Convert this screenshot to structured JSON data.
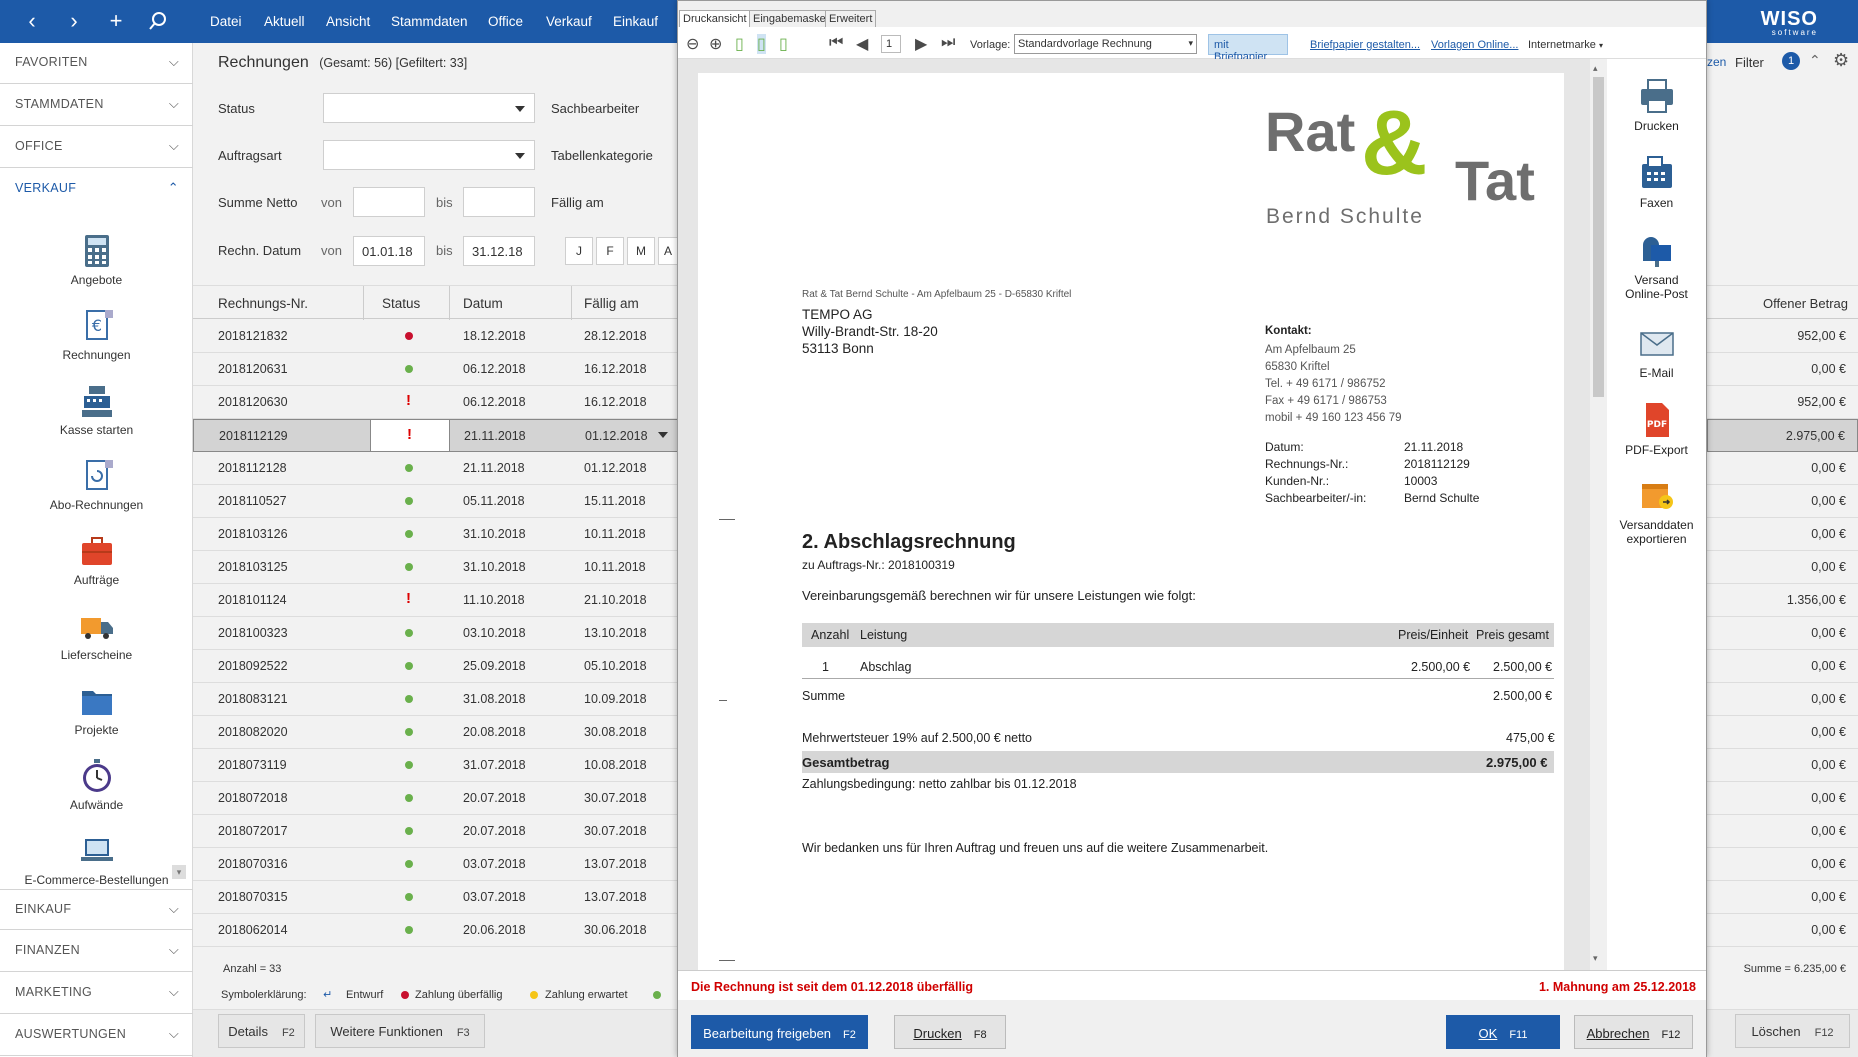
{
  "topbar": {
    "menu": [
      "Datei",
      "Aktuell",
      "Ansicht",
      "Stammdaten",
      "Office",
      "Verkauf",
      "Einkauf"
    ],
    "brand": "WISO",
    "brand_sub": "software"
  },
  "sidebar": {
    "sections_top": [
      "FAVORITEN",
      "STAMMDATEN",
      "OFFICE",
      "VERKAUF"
    ],
    "modules": [
      "Angebote",
      "Rechnungen",
      "Kasse starten",
      "Abo-Rechnungen",
      "Aufträge",
      "Lieferscheine",
      "Projekte",
      "Aufwände",
      "E-Commerce-Bestellungen"
    ],
    "sections_bottom": [
      "EINKAUF",
      "FINANZEN",
      "MARKETING",
      "AUSWERTUNGEN"
    ]
  },
  "list": {
    "title": "Rechnungen",
    "counts": "(Gesamt: 56) [Gefiltert: 33]",
    "filters": {
      "status_label": "Status",
      "sachbearbeiter_label": "Sachbearbeiter",
      "auftragsart_label": "Auftragsart",
      "tabellenkategorie_label": "Tabellenkategorie",
      "summe_label": "Summe Netto",
      "von": "von",
      "bis": "bis",
      "faellig_label": "Fällig am",
      "datum_label": "Rechn. Datum",
      "datum_von": "01.01.18",
      "datum_bis": "31.12.18",
      "period_buttons": [
        "J",
        "F",
        "M",
        "A"
      ]
    },
    "columns": [
      "Rechnungs-Nr.",
      "Status",
      "Datum",
      "Fällig am"
    ],
    "rows": [
      {
        "nr": "2018121832",
        "status": "red",
        "datum": "18.12.2018",
        "faellig": "28.12.2018"
      },
      {
        "nr": "2018120631",
        "status": "green",
        "datum": "06.12.2018",
        "faellig": "16.12.2018"
      },
      {
        "nr": "2018120630",
        "status": "excl",
        "datum": "06.12.2018",
        "faellig": "16.12.2018"
      },
      {
        "nr": "2018112129",
        "status": "excl",
        "datum": "21.11.2018",
        "faellig": "01.12.2018"
      },
      {
        "nr": "2018112128",
        "status": "green",
        "datum": "21.11.2018",
        "faellig": "01.12.2018"
      },
      {
        "nr": "2018110527",
        "status": "green",
        "datum": "05.11.2018",
        "faellig": "15.11.2018"
      },
      {
        "nr": "2018103126",
        "status": "green",
        "datum": "31.10.2018",
        "faellig": "10.11.2018"
      },
      {
        "nr": "2018103125",
        "status": "green",
        "datum": "31.10.2018",
        "faellig": "10.11.2018"
      },
      {
        "nr": "2018101124",
        "status": "excl",
        "datum": "11.10.2018",
        "faellig": "21.10.2018"
      },
      {
        "nr": "2018100323",
        "status": "green",
        "datum": "03.10.2018",
        "faellig": "13.10.2018"
      },
      {
        "nr": "2018092522",
        "status": "green",
        "datum": "25.09.2018",
        "faellig": "05.10.2018"
      },
      {
        "nr": "2018083121",
        "status": "green",
        "datum": "31.08.2018",
        "faellig": "10.09.2018"
      },
      {
        "nr": "2018082020",
        "status": "green",
        "datum": "20.08.2018",
        "faellig": "30.08.2018"
      },
      {
        "nr": "2018073119",
        "status": "green",
        "datum": "31.07.2018",
        "faellig": "10.08.2018"
      },
      {
        "nr": "2018072018",
        "status": "green",
        "datum": "20.07.2018",
        "faellig": "30.07.2018"
      },
      {
        "nr": "2018072017",
        "status": "green",
        "datum": "20.07.2018",
        "faellig": "30.07.2018"
      },
      {
        "nr": "2018070316",
        "status": "green",
        "datum": "03.07.2018",
        "faellig": "13.07.2018"
      },
      {
        "nr": "2018070315",
        "status": "green",
        "datum": "03.07.2018",
        "faellig": "13.07.2018"
      },
      {
        "nr": "2018062014",
        "status": "green",
        "datum": "20.06.2018",
        "faellig": "30.06.2018"
      }
    ],
    "anzahl": "Anzahl = 33",
    "legend": {
      "label": "Symbolerklärung:",
      "entwurf": "Entwurf",
      "ueberfaellig": "Zahlung überfällig",
      "erwartet": "Zahlung erwartet"
    },
    "buttons": {
      "details": "Details",
      "details_key": "F2",
      "weitere": "Weitere Funktionen",
      "weitere_key": "F3"
    }
  },
  "right": {
    "zen": "zen",
    "filter": "Filter",
    "filter_count": "1",
    "col_head": "Offener Betrag",
    "values": [
      "952,00 €",
      "0,00 €",
      "952,00 €",
      "2.975,00 €",
      "0,00 €",
      "0,00 €",
      "0,00 €",
      "0,00 €",
      "1.356,00 €",
      "0,00 €",
      "0,00 €",
      "0,00 €",
      "0,00 €",
      "0,00 €",
      "0,00 €",
      "0,00 €",
      "0,00 €",
      "0,00 €",
      "0,00 €"
    ],
    "summe": "Summe = 6.235,00 €",
    "loeschen": "Löschen",
    "loeschen_key": "F12"
  },
  "dialog": {
    "tabs": [
      "Druckansicht",
      "Eingabemaske",
      "Erweitert"
    ],
    "toolbar": {
      "page": "1",
      "vorlage_label": "Vorlage:",
      "vorlage_value": "Standardvorlage Rechnung",
      "briefpapier_btn": "mit Briefpapier",
      "link1": "Briefpapier gestalten...",
      "link2": "Vorlagen Online...",
      "internetmarke": "Internetmarke"
    },
    "invoice": {
      "logo_rat": "Rat",
      "logo_amp": "&",
      "logo_tat": "Tat",
      "logo_sub": "Bernd Schulte",
      "sender_line": "Rat & Tat Bernd Schulte - Am Apfelbaum 25 - D-65830 Kriftel",
      "recipient": [
        "TEMPO AG",
        "Willy-Brandt-Str. 18-20",
        "53113 Bonn"
      ],
      "kontakt_label": "Kontakt:",
      "kontakt": [
        "Am Apfelbaum 25",
        "65830 Kriftel",
        "Tel. + 49 6171 / 986752",
        "Fax + 49 6171 / 986753",
        "mobil + 49 160 123 456 79"
      ],
      "meta_labels": [
        "Datum:",
        "Rechnungs-Nr.:",
        "Kunden-Nr.:",
        "Sachbearbeiter/-in:"
      ],
      "meta_values": [
        "21.11.2018",
        "2018112129",
        "10003",
        "Bernd Schulte"
      ],
      "heading": "2. Abschlagsrechnung",
      "auftrag": "zu Auftrags-Nr.: 2018100319",
      "intro": "Vereinbarungsgemäß berechnen wir für unsere Leistungen wie folgt:",
      "col_anzahl": "Anzahl",
      "col_leistung": "Leistung",
      "col_preis": "Preis/Einheit",
      "col_gesamt": "Preis gesamt",
      "item_anzahl": "1",
      "item_leistung": "Abschlag",
      "item_preis": "2.500,00 €",
      "item_gesamt": "2.500,00 €",
      "summe_label": "Summe",
      "summe_value": "2.500,00 €",
      "mwst_label": "Mehrwertsteuer 19% auf 2.500,00 € netto",
      "mwst_value": "475,00 €",
      "gesamt_label": "Gesamtbetrag",
      "gesamt_value": "2.975,00 €",
      "zahlung": "Zahlungsbedingung: netto zahlbar bis 01.12.2018",
      "dank": "Wir bedanken uns für Ihren Auftrag und freuen uns auf die weitere Zusammenarbeit."
    },
    "actions": [
      "Drucken",
      "Faxen",
      "Versand Online-Post",
      "E-Mail",
      "PDF-Export",
      "Versanddaten exportieren"
    ],
    "status_left": "Die Rechnung ist seit dem 01.12.2018 überfällig",
    "status_right": "1. Mahnung am 25.12.2018",
    "buttons": {
      "freigeben": "Bearbeitung freigeben",
      "freigeben_key": "F2",
      "drucken": "Drucken",
      "drucken_key": "F8",
      "ok": "OK",
      "ok_key": "F11",
      "abbrechen": "Abbrechen",
      "abbrechen_key": "F12"
    }
  },
  "colors": {
    "brand_blue": "#1d5aa8",
    "status_red": "#c8102e",
    "status_green": "#6ab04c",
    "status_yellow": "#f5c518",
    "logo_gray": "#6e6e6e",
    "logo_green": "#9bc31c",
    "alert_red": "#d00000"
  }
}
